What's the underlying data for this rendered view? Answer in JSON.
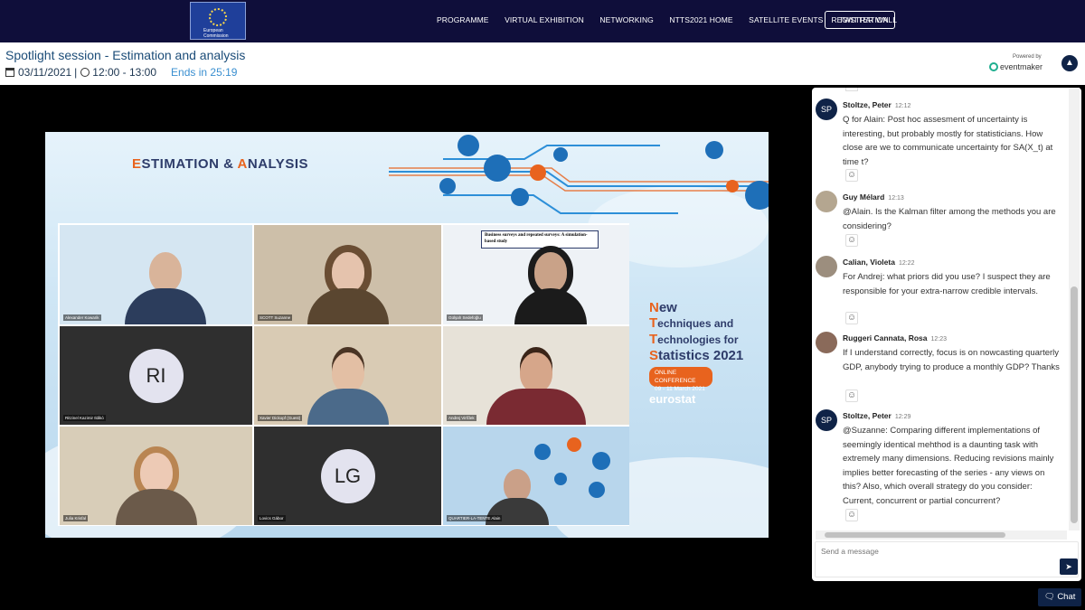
{
  "nav": {
    "logo_caption": "European Commission",
    "items": [
      "PROGRAMME",
      "VIRTUAL EXHIBITION",
      "NETWORKING",
      "NTTS2021 HOME",
      "SATELLITE EVENTS",
      "TWITTER WALL"
    ],
    "registration": "REGISTRATION"
  },
  "session": {
    "title": "Spotlight session - Estimation and analysis",
    "date": "03/11/2021",
    "separator": "|",
    "time": "12:00 - 13:00",
    "ends": "Ends in 25:19",
    "powered_by": "Powered by",
    "brand": "eventmaker"
  },
  "slide": {
    "title_prefix": "E",
    "title_mid": "STIMATION & ",
    "title_a": "A",
    "title_rest": "NALYSIS",
    "ntts_lines": [
      {
        "initial": "N",
        "rest": "ew"
      },
      {
        "initial": "T",
        "rest": "echniques and"
      },
      {
        "initial": "T",
        "rest": "echnologies for"
      },
      {
        "initial": "S",
        "rest": "tatistics 2021"
      }
    ],
    "badge_line1": "ONLINE CONFERENCE",
    "badge_line2": "09 - 11 March 2021",
    "eurostat": "eurostat"
  },
  "participants": [
    {
      "label": "Alexander Kowarik",
      "type": "video",
      "skin": "#d9b49a",
      "shirt": "#2c3d5c"
    },
    {
      "label": "SCOTT Suzanne",
      "type": "video",
      "skin": "#e5c3ad",
      "shirt": "#5a4630"
    },
    {
      "label": "Gülşah Sedefoğlu",
      "type": "slide",
      "skin": "#c9a288",
      "shirt": "#1b1b1b",
      "slide_title": "Business surveys and repeated surveys: A simulation-based study"
    },
    {
      "label": "Ritzinel Kazimir Ildikó",
      "type": "initials",
      "initials": "RI"
    },
    {
      "label": "Xavier Dickopf (Guest)",
      "type": "video",
      "skin": "#e3bfa4",
      "shirt": "#4b6a8a"
    },
    {
      "label": "Andrej Virlčlek",
      "type": "video",
      "skin": "#d6a68a",
      "shirt": "#7a2a32"
    },
    {
      "label": "Julia Krisfal",
      "type": "video",
      "skin": "#edcab5",
      "shirt": "#6b5a4a"
    },
    {
      "label": "Lovics Gábor",
      "type": "initials",
      "initials": "LG"
    },
    {
      "label": "QUARTIER-LA-TENTE Alain",
      "type": "video",
      "skin": "#caa088",
      "shirt": "#3a3a3a"
    }
  ],
  "chat": {
    "messages": [
      {
        "initials": "SP",
        "name": "Stoltze, Peter",
        "time": "12:12",
        "text": "Q for Alain: Post hoc assesment of uncertainty is interesting, but probably mostly for statisticians. How close are we to communicate uncertainty for SA(X_t) at time t?",
        "reaction": "☺"
      },
      {
        "initials": "",
        "name": "Guy Mélard",
        "time": "12:13",
        "text": "@Alain. Is the Kalman filter among the methods you are considering?",
        "reaction": "☺"
      },
      {
        "initials": "",
        "name": "Calian, Violeta",
        "time": "12:22",
        "text": "For Andrej: what priors did you use? I suspect they are responsible for your extra-narrow credible intervals.",
        "reaction": "☺"
      },
      {
        "initials": "",
        "name": "Ruggeri Cannata, Rosa",
        "time": "12:23",
        "text": "If I understand correctly, focus is on nowcasting quarterly GDP, anybody trying to produce a monthly GDP? Thanks",
        "reaction": "☺"
      },
      {
        "initials": "SP",
        "name": "Stoltze, Peter",
        "time": "12:29",
        "text": "@Suzanne: Comparing different implementations of seemingly identical mehthod is a daunting task with extremely many dimensions. Reducing revisions mainly implies better forecasting of the series - any views on this? Also, which overall strategy do you consider: Current, concurrent or partial concurrent?",
        "reaction": "☺"
      }
    ],
    "input_placeholder": "Send a message",
    "send_icon": "paper-plane-icon",
    "toggle_label": "Chat"
  }
}
